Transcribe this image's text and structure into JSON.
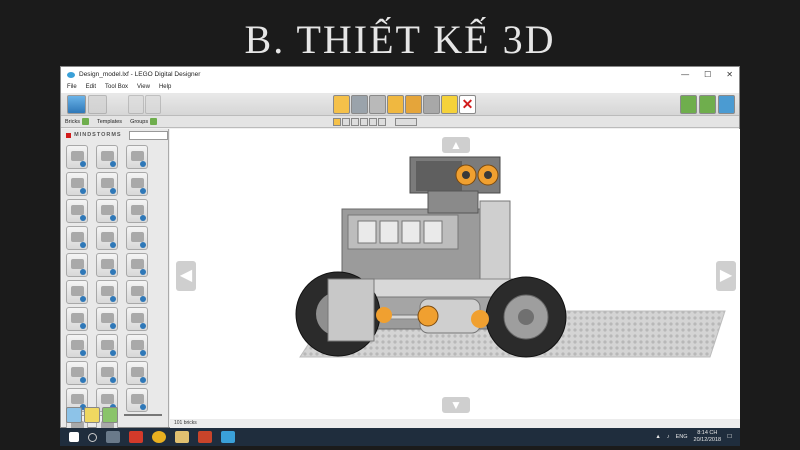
{
  "slide": {
    "title": "B. THIẾT KẾ 3D"
  },
  "window": {
    "title": "Design_model.lxf - LEGO Digital Designer",
    "controls": {
      "minimize": "—",
      "maximize": "☐",
      "close": "✕"
    }
  },
  "menu": [
    "File",
    "Edit",
    "Tool Box",
    "View",
    "Help"
  ],
  "subbar": {
    "bricks": "Bricks",
    "templates": "Templates",
    "groups": "Groups"
  },
  "brand": {
    "text": "MINDSTORMS"
  },
  "status": {
    "text": "101 bricks"
  },
  "nav": {
    "left": "◀",
    "right": "▶",
    "up": "▲",
    "down": "▼"
  },
  "toolbar": {
    "delete_label": "✕"
  },
  "taskbar": {
    "lang": "ENG",
    "time": "8:14 CH",
    "date": "20/12/2018"
  },
  "colors": {
    "accent": "#f5c14a",
    "robot_gray": "#9b9b9b",
    "wheel_orange": "#f0a030"
  },
  "icons": {
    "home": "home-icon",
    "select": "arrow-select-icon",
    "delete": "delete-x-icon"
  }
}
